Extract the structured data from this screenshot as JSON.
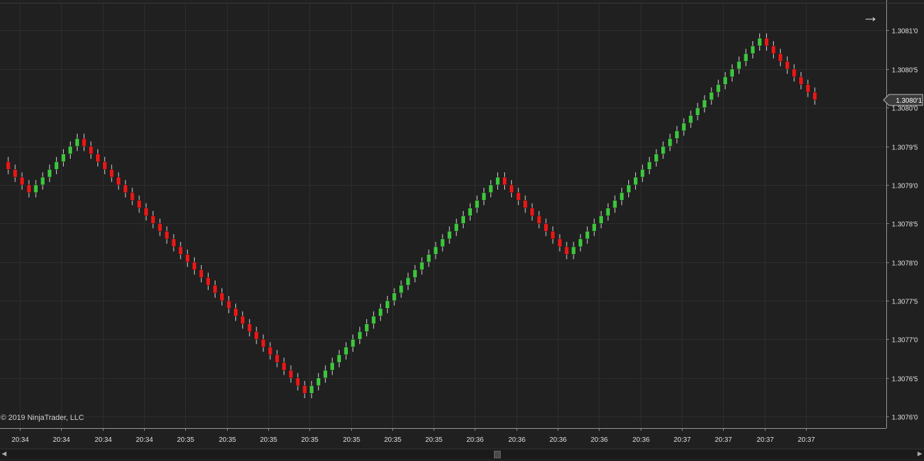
{
  "copyright": "© 2019 NinjaTrader, LLC",
  "nav": {
    "icon": "right-arrow-icon",
    "glyph": "→"
  },
  "colors": {
    "background": "#202020",
    "grid": "#2e2e2e",
    "up": "#3ec43e",
    "down": "#e81818",
    "axis_text": "#e0e0e0",
    "wick": "#d8d8d8"
  },
  "chart_data": {
    "type": "candlestick",
    "brick_size": 1e-05,
    "price_ticks": [
      "1.3081'0",
      "1.3080'5",
      "1.3080'0",
      "1.3079'5",
      "1.3079'0",
      "1.3078'5",
      "1.3078'0",
      "1.3077'5",
      "1.3077'0",
      "1.3076'5",
      "1.3076'0"
    ],
    "price_tick_values": [
      1.3081,
      1.30805,
      1.308,
      1.30795,
      1.3079,
      1.30785,
      1.3078,
      1.30775,
      1.3077,
      1.30765,
      1.3076
    ],
    "ylim": [
      1.307585,
      1.308135
    ],
    "time_ticks": [
      "20:34",
      "20:34",
      "20:34",
      "20:34",
      "20:35",
      "20:35",
      "20:35",
      "20:35",
      "20:35",
      "20:35",
      "20:35",
      "20:36",
      "20:36",
      "20:36",
      "20:36",
      "20:36",
      "20:37",
      "20:37",
      "20:37",
      "20:37"
    ],
    "time_tick_bar_index": [
      2,
      8,
      14,
      20,
      26,
      32,
      38,
      44,
      50,
      56,
      62,
      68,
      74,
      80,
      86,
      92,
      98,
      104,
      110,
      116,
      122
    ],
    "current_price_label": "1.3080'1",
    "current_price": 1.30801,
    "grid": true,
    "segments": [
      {
        "dir": "down",
        "count": 4
      },
      {
        "dir": "up",
        "count": 7
      },
      {
        "dir": "down",
        "count": 33
      },
      {
        "dir": "up",
        "count": 28
      },
      {
        "dir": "down",
        "count": 10
      },
      {
        "dir": "up",
        "count": 28
      },
      {
        "dir": "down",
        "count": 8
      }
    ],
    "start_price": 1.30793
  }
}
